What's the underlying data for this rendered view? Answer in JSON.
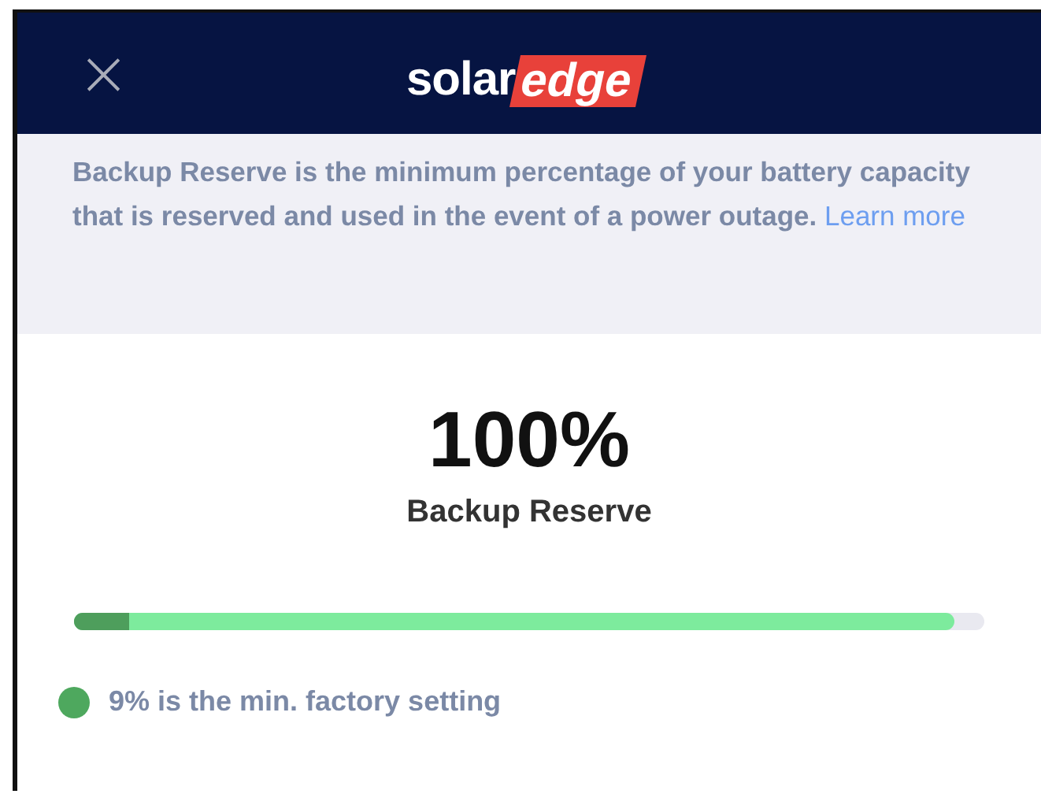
{
  "header": {
    "close": "×",
    "logo_left": "solar",
    "logo_right": "edge"
  },
  "info": {
    "text": "Backup Reserve is the minimum percentage of your battery capacity that is reserved and used in the event of a power outage.",
    "link": "Learn more"
  },
  "reserve": {
    "value": "100%",
    "label": "Backup Reserve"
  },
  "slider": {
    "level": 0.967
  },
  "legend": [
    {
      "text": "9% is the min. factory setting",
      "color": "#4ea85e"
    }
  ]
}
